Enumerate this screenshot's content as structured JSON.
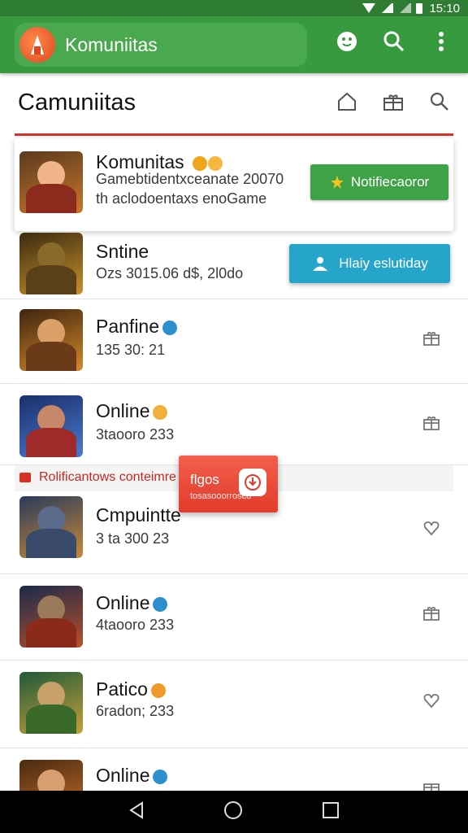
{
  "status": {
    "time": "15:10"
  },
  "appbar": {
    "title": "Komuniitas",
    "icons": [
      "emoji-icon",
      "search-icon",
      "more-vert-icon"
    ]
  },
  "header": {
    "title": "Camuniitas",
    "icons": [
      "home-icon",
      "gift-icon",
      "search-icon"
    ]
  },
  "featured": {
    "title": "Komunitas",
    "line1": "Gamebtidentxceanate 20070",
    "line2": "th aclodoentaxs enoGame",
    "button": "Notifiecaoror"
  },
  "rows": [
    {
      "title": "Sntine",
      "subtitle": "Ozs 3015.06 d$, 2l0do",
      "button": "Hlaiy eslutiday"
    },
    {
      "title": "Panfine",
      "subtitle": "135 30: 21"
    },
    {
      "title": "Online",
      "subtitle": "3taooro 233"
    },
    {
      "title": "Cmpuintte",
      "subtitle": "3 ta 300 23"
    },
    {
      "title": "Online",
      "subtitle": "4taooro 233"
    },
    {
      "title": "Patico",
      "subtitle": "6radon; 233"
    },
    {
      "title": "Online",
      "subtitle": ""
    }
  ],
  "banner": {
    "text": "Rolificantows conteimre"
  },
  "popup": {
    "title": "flgos",
    "subtitle": "tosasooorrosco"
  },
  "colors": {
    "appbar": "#389a3f",
    "status": "#2e7d32",
    "accent_red": "#d93025",
    "green_button": "#3fa246",
    "blue_button": "#25a5c9"
  }
}
